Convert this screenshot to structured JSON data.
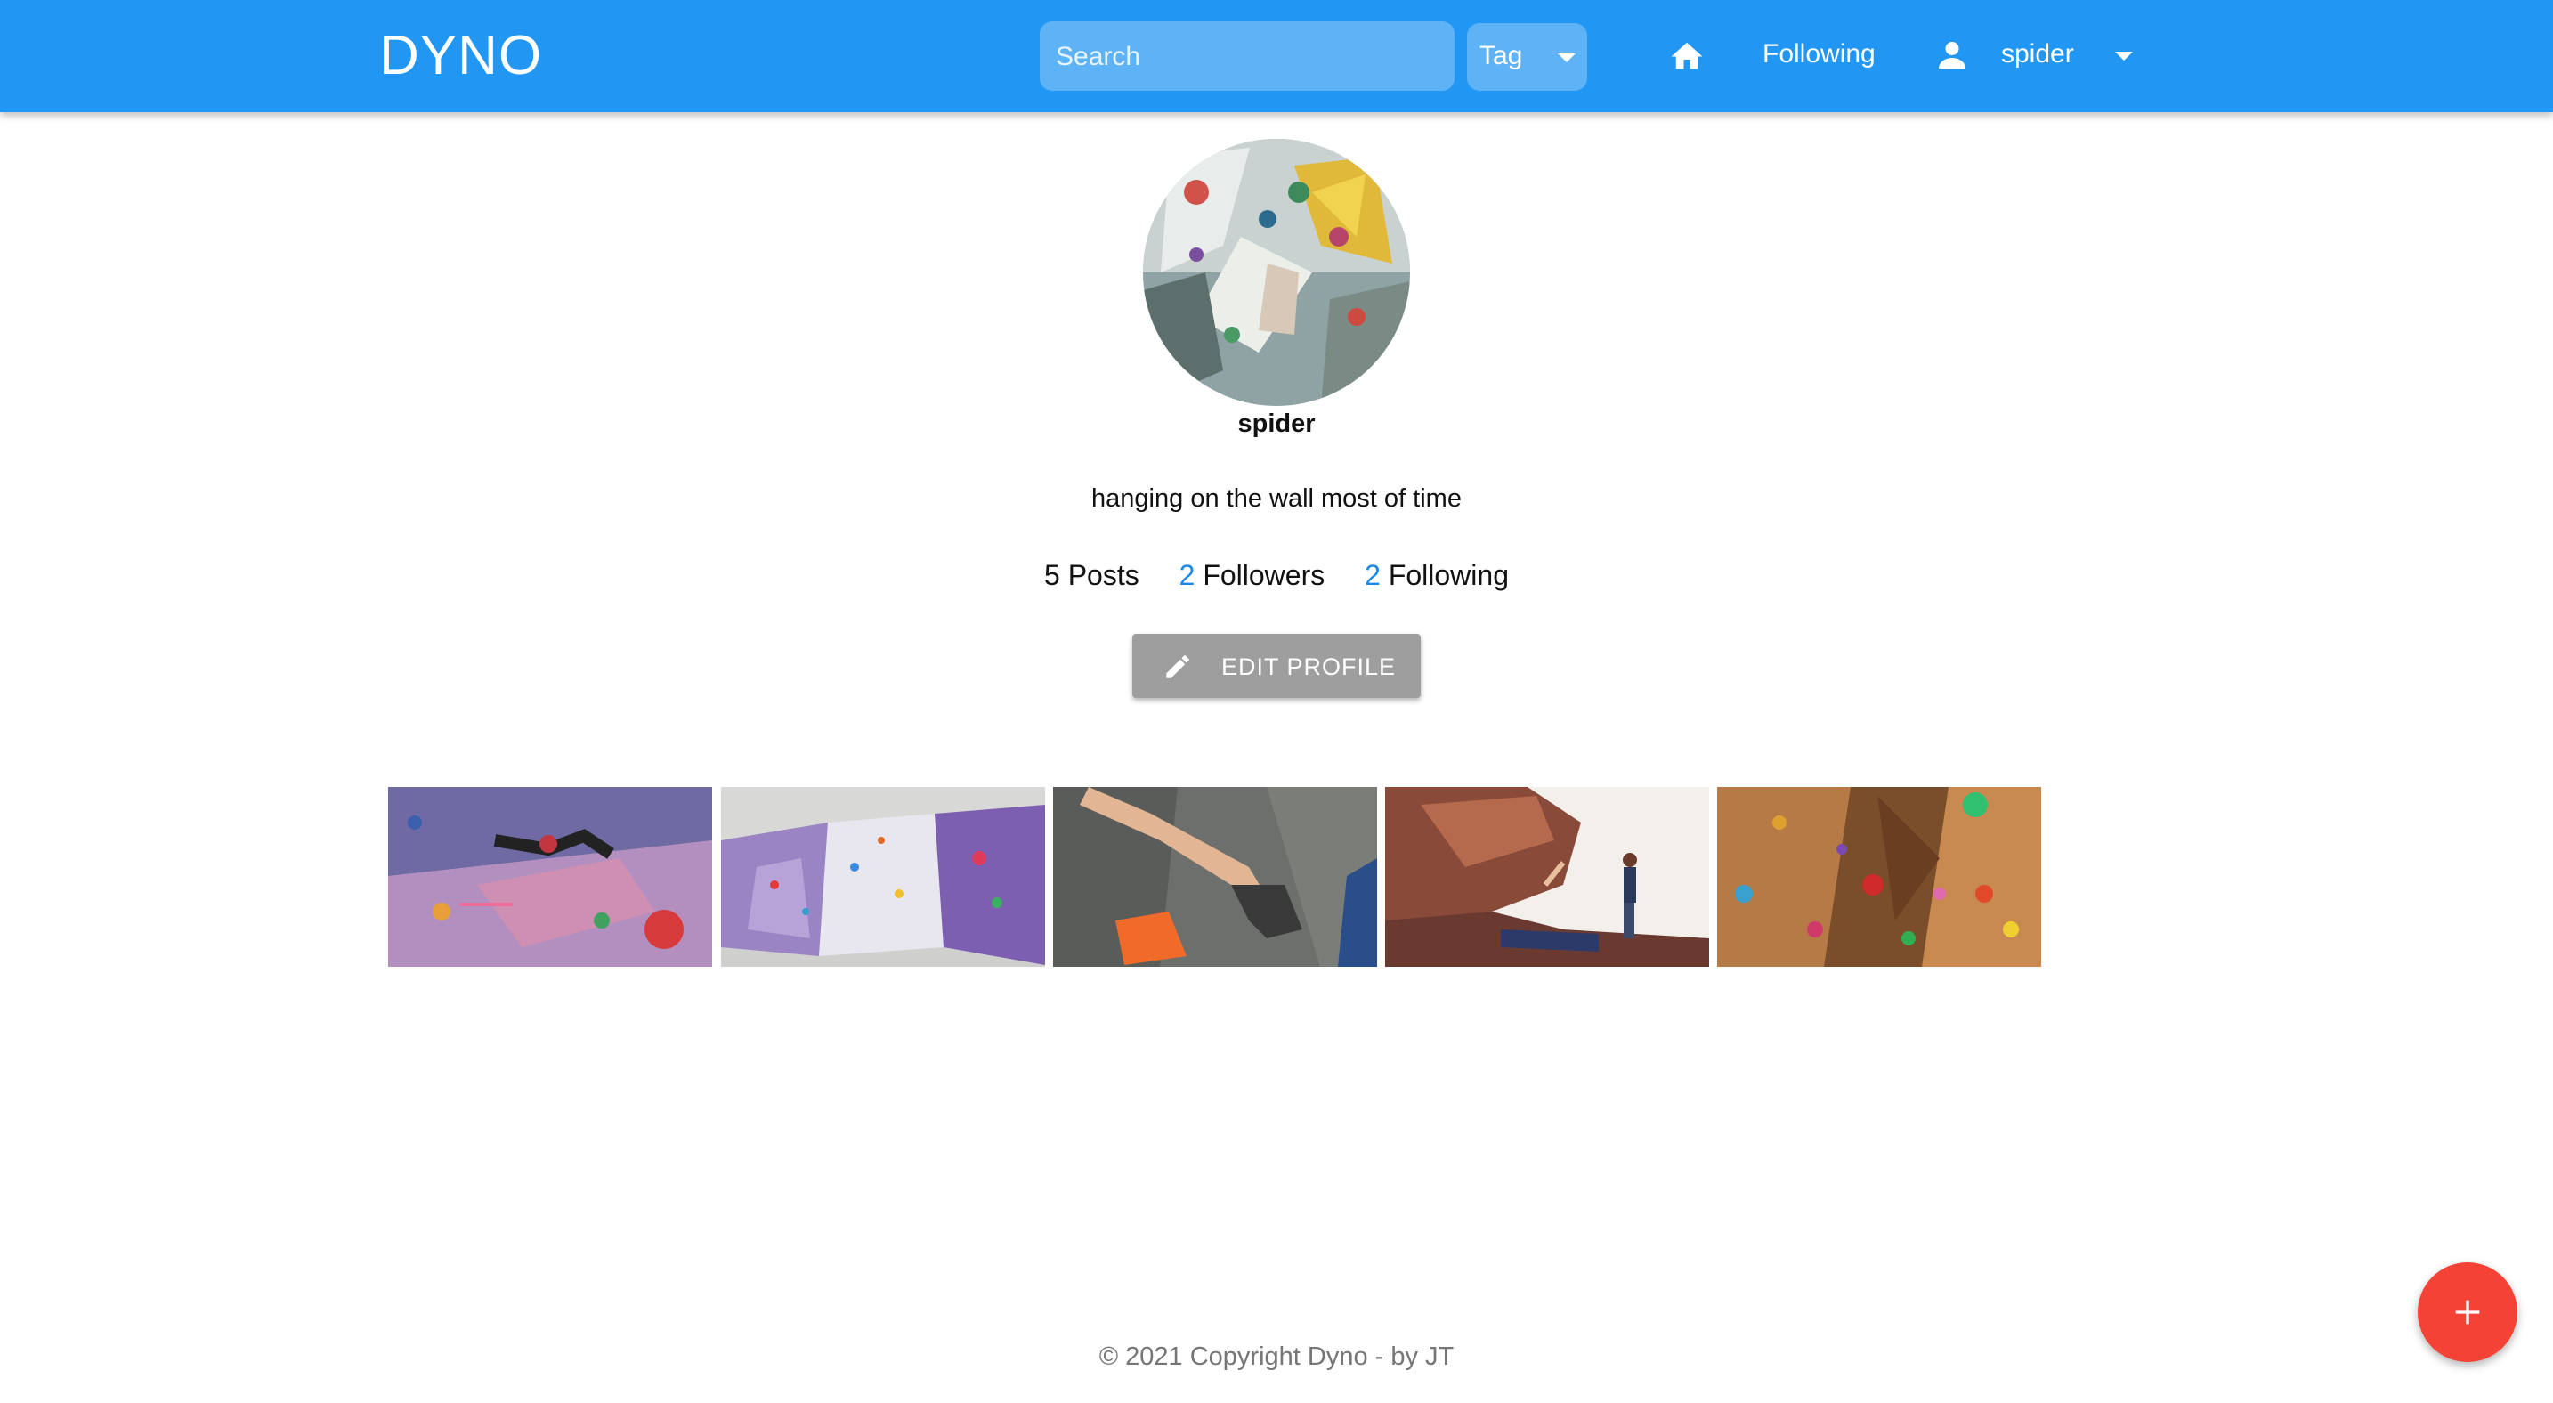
{
  "header": {
    "brand": "DYNO",
    "search_placeholder": "Search",
    "tag_select": "Tag",
    "home_icon": "home-icon",
    "following_link": "Following",
    "user_icon": "person-icon",
    "username": "spider"
  },
  "profile": {
    "username": "spider",
    "bio": "hanging on the wall most of time",
    "stats": {
      "posts_count": "5",
      "posts_label": "Posts",
      "followers_count": "2",
      "followers_label": "Followers",
      "following_count": "2",
      "following_label": "Following"
    },
    "edit_button": "EDIT PROFILE",
    "edit_icon": "pencil-icon"
  },
  "posts": [
    {
      "name": "post-1"
    },
    {
      "name": "post-2"
    },
    {
      "name": "post-3"
    },
    {
      "name": "post-4"
    },
    {
      "name": "post-5"
    }
  ],
  "footer": {
    "copyright": "© 2021 Copyright Dyno - by JT"
  },
  "fab": {
    "icon": "plus-icon"
  },
  "colors": {
    "appbar": "#2196f3",
    "link": "#1e88e5",
    "edit_button": "#9e9e9e",
    "fab": "#f44336"
  }
}
